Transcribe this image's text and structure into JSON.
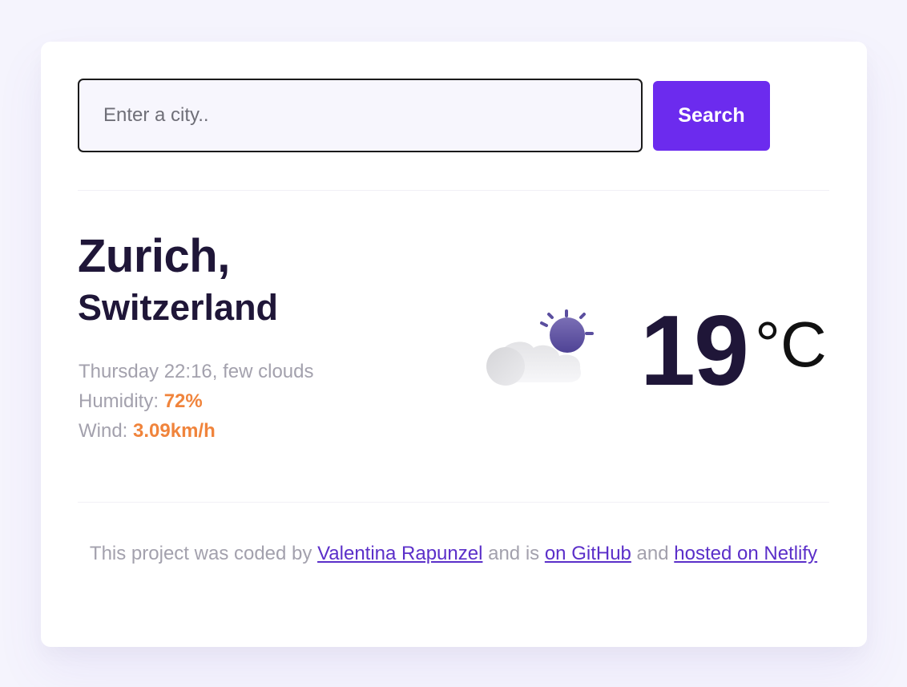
{
  "search": {
    "placeholder": "Enter a city..",
    "value": "",
    "button_label": "Search"
  },
  "location": {
    "city": "Zurich,",
    "country": "Switzerland"
  },
  "details": {
    "datetime_description": "Thursday 22:16, few clouds",
    "humidity_label": "Humidity: ",
    "humidity_value": "72%",
    "wind_label": "Wind: ",
    "wind_value": "3.09km/h"
  },
  "current": {
    "temperature": "19",
    "unit": "°C",
    "icon": "partly-cloudy-icon"
  },
  "footer": {
    "prefix": "This project was coded by ",
    "author_link": "Valentina Rapunzel",
    "middle": " and is ",
    "github_link": "on GitHub",
    "and_text": " and ",
    "netlify_link": "hosted on Netlify"
  },
  "colors": {
    "accent": "#6c2bee",
    "highlight": "#f0843c",
    "heading": "#1f1638",
    "muted": "#a3a1ad",
    "link": "#5b2fc9"
  }
}
